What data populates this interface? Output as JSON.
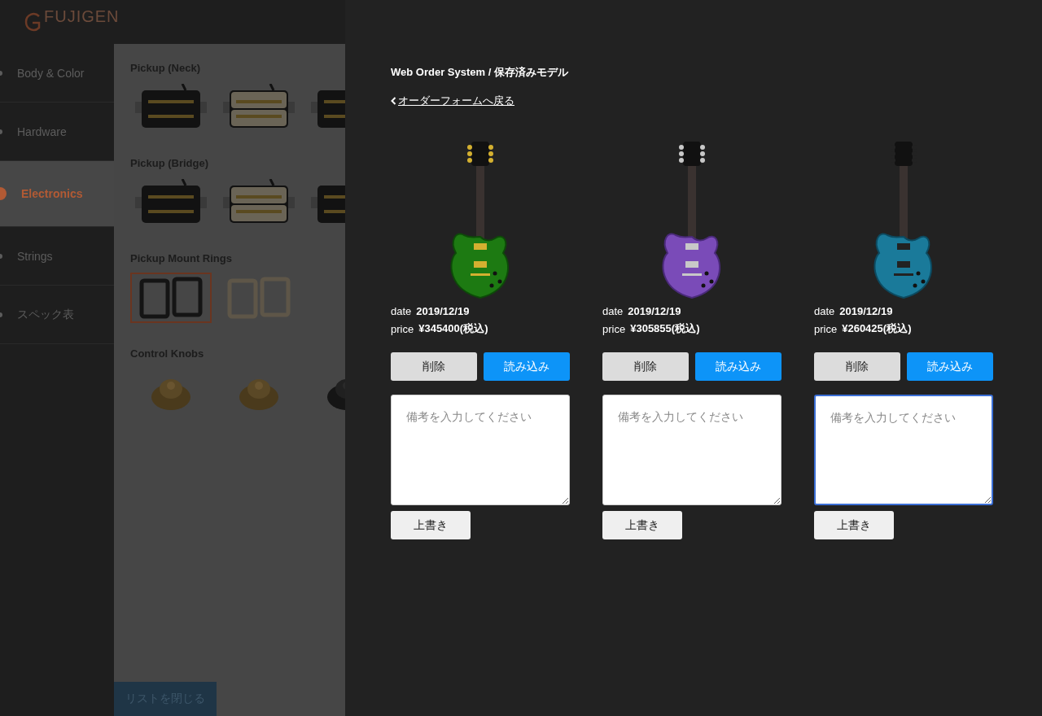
{
  "logo": {
    "text": "FUJIGEN"
  },
  "sidebar": {
    "items": [
      {
        "label": "Body & Color",
        "selected": false
      },
      {
        "label": "Hardware",
        "selected": false
      },
      {
        "label": "Electronics",
        "selected": true
      },
      {
        "label": "Strings",
        "selected": false
      },
      {
        "label": "スペック表",
        "selected": false
      }
    ]
  },
  "sections": [
    {
      "title": "Pickup (Neck)",
      "kind": "pickup",
      "options": [
        {
          "selected": false
        },
        {
          "selected": false
        },
        {
          "selected": false
        }
      ]
    },
    {
      "title": "Pickup (Bridge)",
      "kind": "pickup",
      "options": [
        {
          "selected": false
        },
        {
          "selected": false
        },
        {
          "selected": false
        }
      ]
    },
    {
      "title": "Pickup Mount Rings",
      "kind": "ring",
      "options": [
        {
          "selected": true
        },
        {
          "selected": false
        }
      ]
    },
    {
      "title": "Control Knobs",
      "kind": "knob",
      "options": [
        {
          "selected": false
        },
        {
          "selected": false
        },
        {
          "selected": false
        }
      ]
    }
  ],
  "close_button": "リストを閉じる",
  "panel": {
    "breadcrumb": "Web Order System / 保存済みモデル",
    "back_link": "オーダーフォームへ戻る",
    "models": [
      {
        "date_label": "date",
        "date": "2019/12/19",
        "price_label": "price",
        "price": "¥345400(税込)",
        "delete_button": "削除",
        "load_button": "読み込み",
        "note": {
          "placeholder": "備考を入力してください",
          "focused": false
        },
        "save_button": "上書き"
      },
      {
        "date_label": "date",
        "date": "2019/12/19",
        "price_label": "price",
        "price": "¥305855(税込)",
        "delete_button": "削除",
        "load_button": "読み込み",
        "note": {
          "placeholder": "備考を入力してください",
          "focused": false
        },
        "save_button": "上書き"
      },
      {
        "date_label": "date",
        "date": "2019/12/19",
        "price_label": "price",
        "price": "¥260425(税込)",
        "delete_button": "削除",
        "load_button": "読み込み",
        "note": {
          "placeholder": "備考を入力してください",
          "focused": true
        },
        "save_button": "上書き"
      }
    ]
  }
}
